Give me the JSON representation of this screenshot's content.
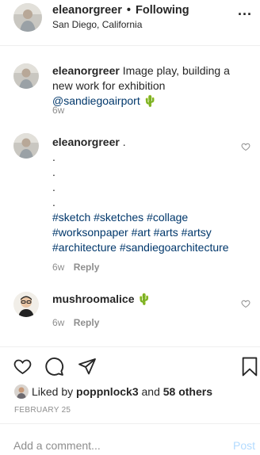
{
  "header": {
    "username": "eleanorgreer",
    "separator": "•",
    "follow_status": "Following",
    "location": "San Diego, California",
    "more_label": "..."
  },
  "comments": [
    {
      "username": "eleanorgreer",
      "text": "Image play, building a new work for exhibition",
      "mention": "@sandiegoairport",
      "emoji": "🌵",
      "time": "6w",
      "reply": ""
    },
    {
      "username": "eleanorgreer",
      "text": ".",
      "dots": [
        ".",
        ".",
        ".",
        "."
      ],
      "hashtags_1": "#sketch #sketches #collage",
      "hashtags_2": "#worksonpaper #art #arts #artsy",
      "hashtags_3": "#architecture #sandiegoarchitecture",
      "time": "6w",
      "reply": "Reply"
    },
    {
      "username": "mushroomalice",
      "emoji": "🌵",
      "time": "6w",
      "reply": "Reply"
    }
  ],
  "likes": {
    "prefix": "Liked by",
    "user": "poppnlock3",
    "and": "and",
    "others": "58 others"
  },
  "date": "FEBRUARY 25",
  "add_comment": {
    "placeholder": "Add a comment...",
    "post_label": "Post"
  },
  "colors": {
    "link": "#00376b",
    "muted": "#8e8e8e",
    "post_disabled": "#b3dbff"
  },
  "icons": [
    "heart-icon",
    "comment-icon",
    "share-icon",
    "bookmark-icon",
    "more-icon",
    "cactus-emoji"
  ]
}
